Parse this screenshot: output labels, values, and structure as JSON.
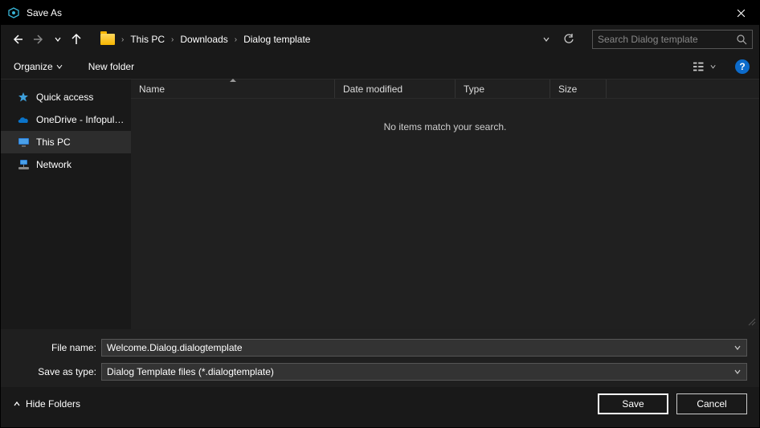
{
  "titlebar": {
    "title": "Save As"
  },
  "nav": {
    "breadcrumbs": [
      "This PC",
      "Downloads",
      "Dialog template"
    ],
    "search_placeholder": "Search Dialog template"
  },
  "toolbar": {
    "organize_label": "Organize",
    "newfolder_label": "New folder"
  },
  "sidebar": {
    "items": [
      {
        "label": "Quick access",
        "icon": "star"
      },
      {
        "label": "OneDrive - Infopulse",
        "icon": "cloud"
      },
      {
        "label": "This PC",
        "icon": "monitor",
        "selected": true
      },
      {
        "label": "Network",
        "icon": "network"
      }
    ]
  },
  "columns": {
    "name": "Name",
    "date": "Date modified",
    "type": "Type",
    "size": "Size"
  },
  "content": {
    "empty_message": "No items match your search."
  },
  "fields": {
    "filename_label": "File name:",
    "filename_value": "Welcome.Dialog.dialogtemplate",
    "type_label": "Save as type:",
    "type_value": "Dialog Template files  (*.dialogtemplate)"
  },
  "footer": {
    "hide_folders_label": "Hide Folders",
    "save_label": "Save",
    "cancel_label": "Cancel"
  }
}
